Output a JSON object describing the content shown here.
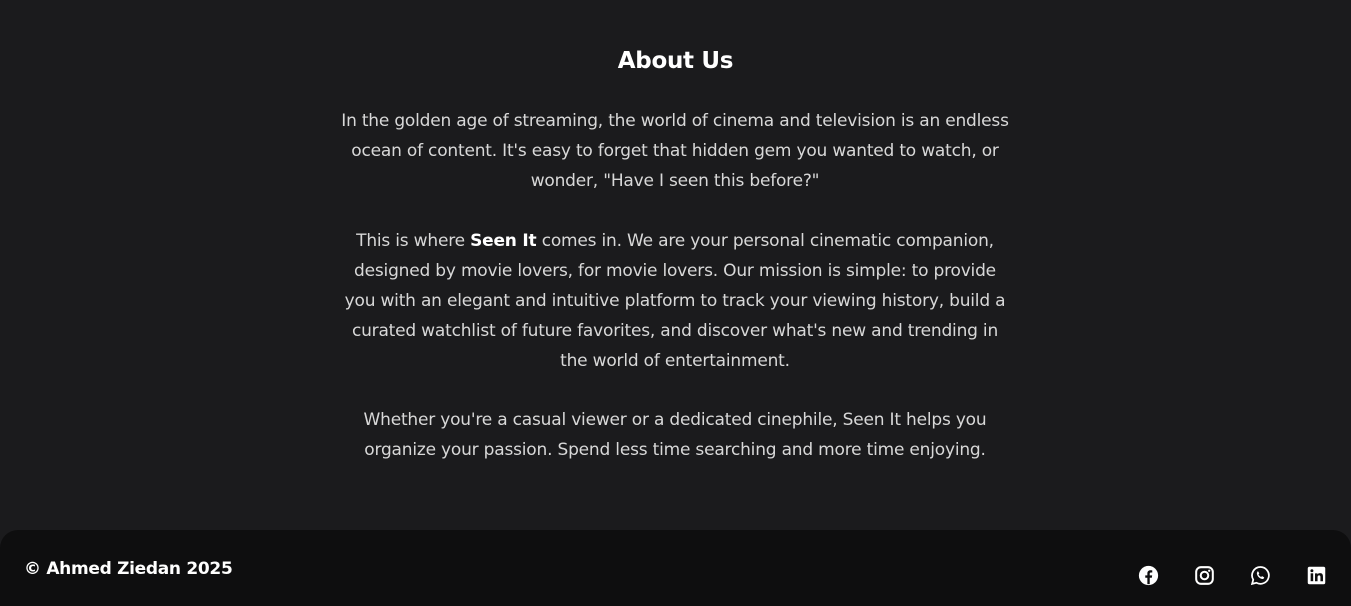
{
  "about": {
    "title": "About Us",
    "paragraph1": "In the golden age of streaming, the world of cinema and television is an endless ocean of content. It's easy to forget that hidden gem you wanted to watch, or wonder, \"Have I seen this before?\"",
    "paragraph2_before": "This is where ",
    "paragraph2_brand": "Seen It",
    "paragraph2_after": " comes in. We are your personal cinematic companion, designed by movie lovers, for movie lovers. Our mission is simple: to provide you with an elegant and intuitive platform to track your viewing history, build a curated watchlist of future favorites, and discover what's new and trending in the world of entertainment.",
    "paragraph3": "Whether you're a casual viewer or a dedicated cinephile, Seen It helps you organize your passion. Spend less time searching and more time enjoying."
  },
  "footer": {
    "copyright": "© Ahmed Ziedan 2025",
    "socials": [
      {
        "icon": "facebook-icon"
      },
      {
        "icon": "instagram-icon"
      },
      {
        "icon": "whatsapp-icon"
      },
      {
        "icon": "linkedin-icon"
      }
    ]
  },
  "colors": {
    "background": "#1b1b1d",
    "footer_background": "#0e0e0f",
    "text": "#d8d8d8",
    "heading": "#ffffff"
  }
}
